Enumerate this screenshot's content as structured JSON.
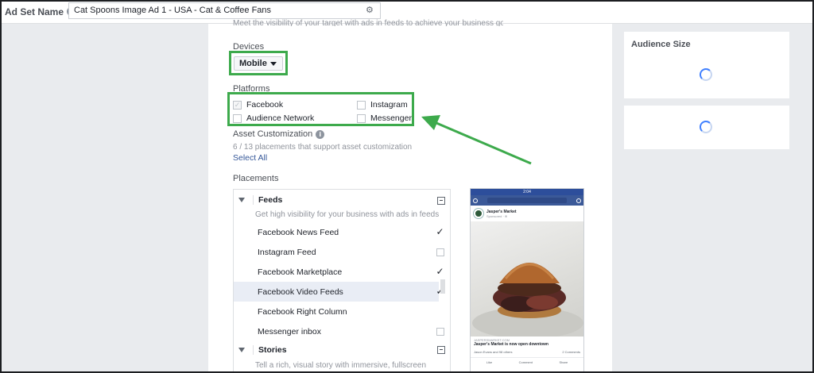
{
  "topbar": {
    "label": "Ad Set Name",
    "value": "Cat Spoons Image Ad 1 - USA - Cat & Coffee Fans",
    "settings_icon": "gear-icon"
  },
  "cutoff_text": "Meet the visibility of your target with ads in feeds to achieve your business goals. Learn more",
  "devices": {
    "heading": "Devices",
    "selected": "Mobile"
  },
  "platforms": {
    "heading": "Platforms",
    "items": [
      {
        "label": "Facebook",
        "checked": true
      },
      {
        "label": "Instagram",
        "checked": false
      },
      {
        "label": "Audience Network",
        "checked": false
      },
      {
        "label": "Messenger",
        "checked": false
      }
    ]
  },
  "asset": {
    "heading": "Asset Customization",
    "sub": "6 / 13 placements that support asset customization",
    "select_all": "Select All"
  },
  "placements": {
    "heading": "Placements",
    "groups": [
      {
        "label": "Feeds",
        "desc": "Get high visibility for your business with ads in feeds"
      },
      {
        "label": "Stories",
        "desc": "Tell a rich, visual story with immersive, fullscreen"
      }
    ],
    "rows": [
      {
        "label": "Facebook News Feed",
        "checked": true
      },
      {
        "label": "Instagram Feed",
        "checked": false
      },
      {
        "label": "Facebook Marketplace",
        "checked": true
      },
      {
        "label": "Facebook Video Feeds",
        "checked": true
      },
      {
        "label": "Facebook Right Column",
        "checked": false
      },
      {
        "label": "Messenger inbox",
        "checked": false
      }
    ]
  },
  "preview": {
    "time": "2:04",
    "page_name": "Jasper's Market",
    "sponsored": "Sponsored · ⊕",
    "caption": "JASPERSMARKET.COM",
    "headline": "Jasper's Market is now open downtown",
    "reactions": "Jason Evans and 98 others",
    "comments": "2 Comments",
    "actions": [
      "Like",
      "Comment",
      "Share"
    ]
  },
  "sidebar": {
    "audience_title": "Audience Size"
  },
  "colors": {
    "highlight": "#3daa4c",
    "facebook_blue": "#3b5998",
    "link": "#365899"
  }
}
